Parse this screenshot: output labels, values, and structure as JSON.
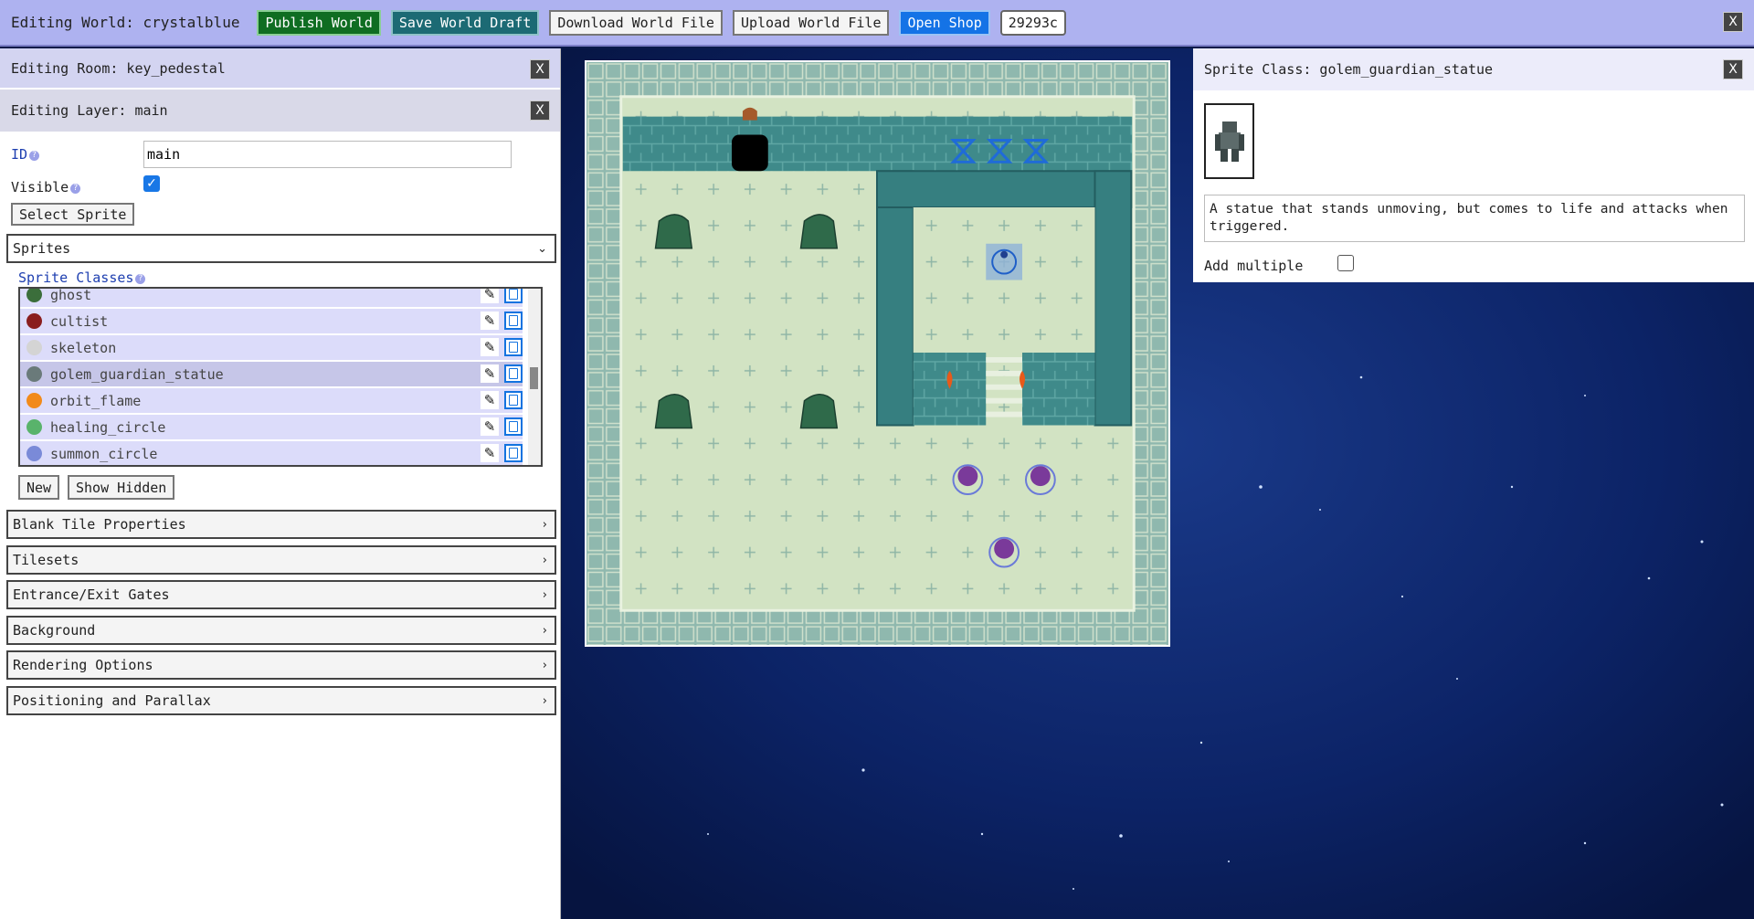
{
  "topbar": {
    "title": "Editing World: crystalblue",
    "publish": "Publish World",
    "save_draft": "Save World Draft",
    "download": "Download World File",
    "upload": "Upload World File",
    "shop": "Open Shop",
    "code": "29293c",
    "close": "X"
  },
  "room": {
    "title": "Editing Room: key_pedestal",
    "close": "X"
  },
  "layer": {
    "title": "Editing Layer: main",
    "close": "X",
    "id_label": "ID",
    "id_value": "main",
    "visible_label": "Visible",
    "visible_checked": true,
    "select_sprite": "Select Sprite"
  },
  "sprites_section": {
    "label": "Sprites",
    "classes_label": "Sprite Classes",
    "items": [
      {
        "name": "ghost",
        "color": "#3b6e3b"
      },
      {
        "name": "cultist",
        "color": "#8a1e1e"
      },
      {
        "name": "skeleton",
        "color": "#cfcfcf"
      },
      {
        "name": "golem_guardian_statue",
        "color": "#6a7a7a"
      },
      {
        "name": "orbit_flame",
        "color": "#f28a1a"
      },
      {
        "name": "healing_circle",
        "color": "#59b36b"
      },
      {
        "name": "summon_circle",
        "color": "#7a8ad8"
      }
    ],
    "selected": "golem_guardian_statue",
    "new_button": "New",
    "show_hidden": "Show Hidden"
  },
  "sections": [
    "Blank Tile Properties",
    "Tilesets",
    "Entrance/Exit Gates",
    "Background",
    "Rendering Options",
    "Positioning and Parallax"
  ],
  "sprite_class_panel": {
    "title": "Sprite Class: golem_guardian_statue",
    "close": "X",
    "description": "A statue that stands unmoving, but comes to life and attacks when triggered.",
    "add_multiple": "Add multiple",
    "add_multiple_checked": false
  },
  "colors": {
    "topbar": "#aeb2f0",
    "accent_blue": "#1473e6",
    "publish_green": "#0f6d22",
    "save_teal": "#1c6a74"
  }
}
